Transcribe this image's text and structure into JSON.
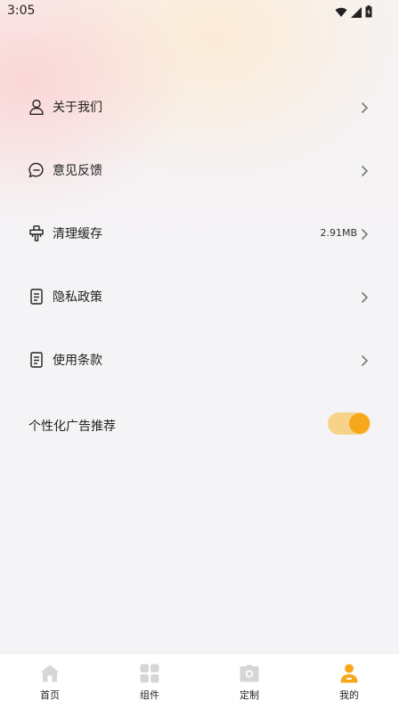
{
  "status_bar": {
    "time": "3:05",
    "icons": [
      "wifi-icon",
      "signal-icon",
      "battery-icon"
    ]
  },
  "settings": {
    "items": [
      {
        "label": "关于我们",
        "icon": "user-icon",
        "value": ""
      },
      {
        "label": "意见反馈",
        "icon": "chat-icon",
        "value": ""
      },
      {
        "label": "清理缓存",
        "icon": "broom-icon",
        "value": "2.91MB"
      },
      {
        "label": "隐私政策",
        "icon": "document-icon",
        "value": ""
      },
      {
        "label": "使用条款",
        "icon": "document-icon",
        "value": ""
      }
    ],
    "ad_toggle": {
      "label": "个性化广告推荐",
      "enabled": true
    }
  },
  "bottom_nav": {
    "items": [
      {
        "label": "首页",
        "icon": "home-icon",
        "active": false
      },
      {
        "label": "组件",
        "icon": "grid-icon",
        "active": false
      },
      {
        "label": "定制",
        "icon": "camera-icon",
        "active": false
      },
      {
        "label": "我的",
        "icon": "profile-icon",
        "active": true
      }
    ]
  },
  "colors": {
    "accent": "#f7a71b",
    "toggle_track": "#f7d38a",
    "inactive_icon": "#d6d6d6",
    "text": "#222222"
  }
}
